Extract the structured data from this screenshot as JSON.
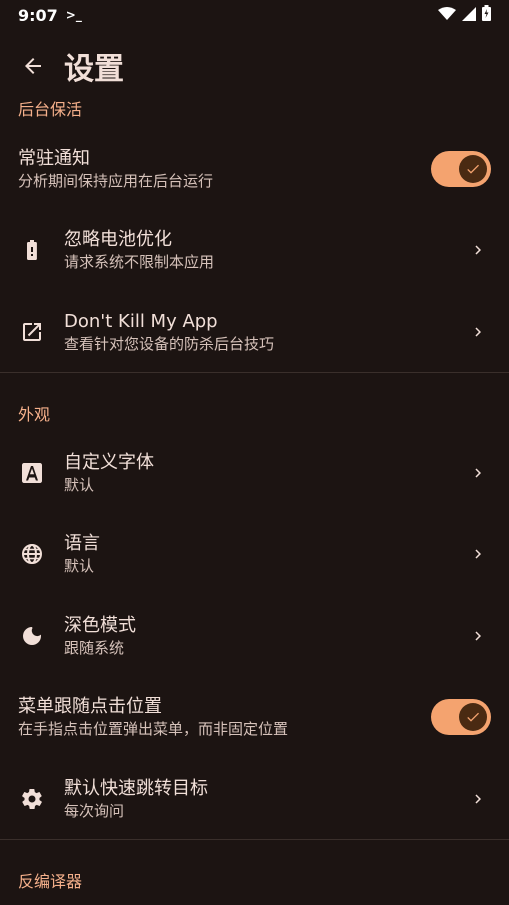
{
  "status_bar": {
    "time": "9:07",
    "terminal_glyph": ">_"
  },
  "header": {
    "title": "设置"
  },
  "sections": {
    "background": {
      "title": "后台保活"
    },
    "appearance": {
      "title": "外观"
    },
    "decompiler": {
      "title": "反编译器"
    }
  },
  "rows": {
    "persistent_notification": {
      "title": "常驻通知",
      "subtitle": "分析期间保持应用在后台运行",
      "enabled": true
    },
    "battery_optimization": {
      "title": "忽略电池优化",
      "subtitle": "请求系统不限制本应用"
    },
    "dont_kill": {
      "title": "Don't Kill My App",
      "subtitle": "查看针对您设备的防杀后台技巧"
    },
    "custom_font": {
      "title": "自定义字体",
      "subtitle": "默认"
    },
    "language": {
      "title": "语言",
      "subtitle": "默认"
    },
    "dark_mode": {
      "title": "深色模式",
      "subtitle": "跟随系统"
    },
    "menu_follow_click": {
      "title": "菜单跟随点击位置",
      "subtitle": "在手指点击位置弹出菜单，而非固定位置",
      "enabled": true
    },
    "quick_jump": {
      "title": "默认快速跳转目标",
      "subtitle": "每次询问"
    }
  },
  "icons": {
    "back": "arrow-left-icon",
    "battery": "battery-alert-icon",
    "external": "open-in-new-icon",
    "font": "font-a-icon",
    "language": "globe-icon",
    "dark": "moon-icon",
    "settings": "gear-icon"
  },
  "colors": {
    "background": "#1c1412",
    "accent": "#f5b08b",
    "toggle_track": "#f4a36f",
    "toggle_thumb": "#4a2a12"
  }
}
